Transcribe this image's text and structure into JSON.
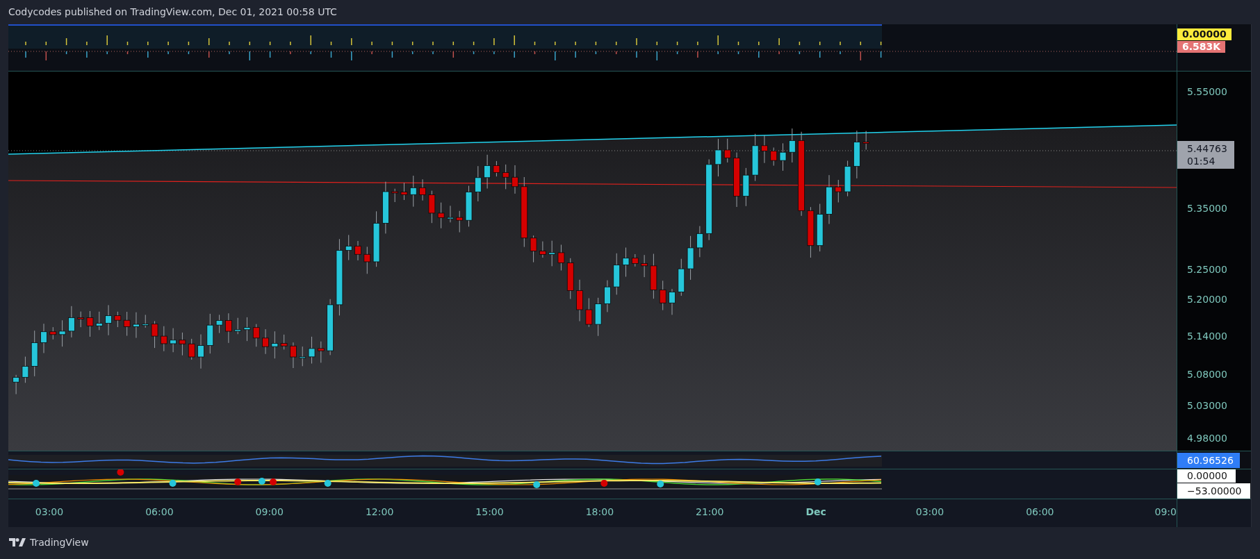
{
  "header": {
    "title": "Codycodes published on TradingView.com, Dec 01, 2021 00:58 UTC"
  },
  "volume_pane": {
    "labels": [
      {
        "text": "0.00000",
        "color": "#ffeb3b"
      },
      {
        "text": "6.583K",
        "color": "#e57373"
      }
    ]
  },
  "price_axis": {
    "ticks": [
      "5.55000",
      "5.35000",
      "5.25000",
      "5.20000",
      "5.14000",
      "5.08000",
      "5.03000",
      "4.98000"
    ]
  },
  "last_price": {
    "price": "5.44763",
    "countdown": "01:54"
  },
  "rsi_pane": {
    "value": "60.96526"
  },
  "oscillator_pane": {
    "labels": [
      "0.00000",
      "−53.00000"
    ]
  },
  "time_axis": {
    "ticks": [
      {
        "label": "03:00",
        "kind": "time"
      },
      {
        "label": "06:00",
        "kind": "time"
      },
      {
        "label": "09:00",
        "kind": "time"
      },
      {
        "label": "12:00",
        "kind": "time"
      },
      {
        "label": "15:00",
        "kind": "time"
      },
      {
        "label": "18:00",
        "kind": "time"
      },
      {
        "label": "21:00",
        "kind": "time"
      },
      {
        "label": "Dec",
        "kind": "day"
      },
      {
        "label": "03:00",
        "kind": "time"
      },
      {
        "label": "06:00",
        "kind": "time"
      },
      {
        "label": "09:0",
        "kind": "time"
      }
    ]
  },
  "footer": {
    "brand": "TradingView"
  }
}
